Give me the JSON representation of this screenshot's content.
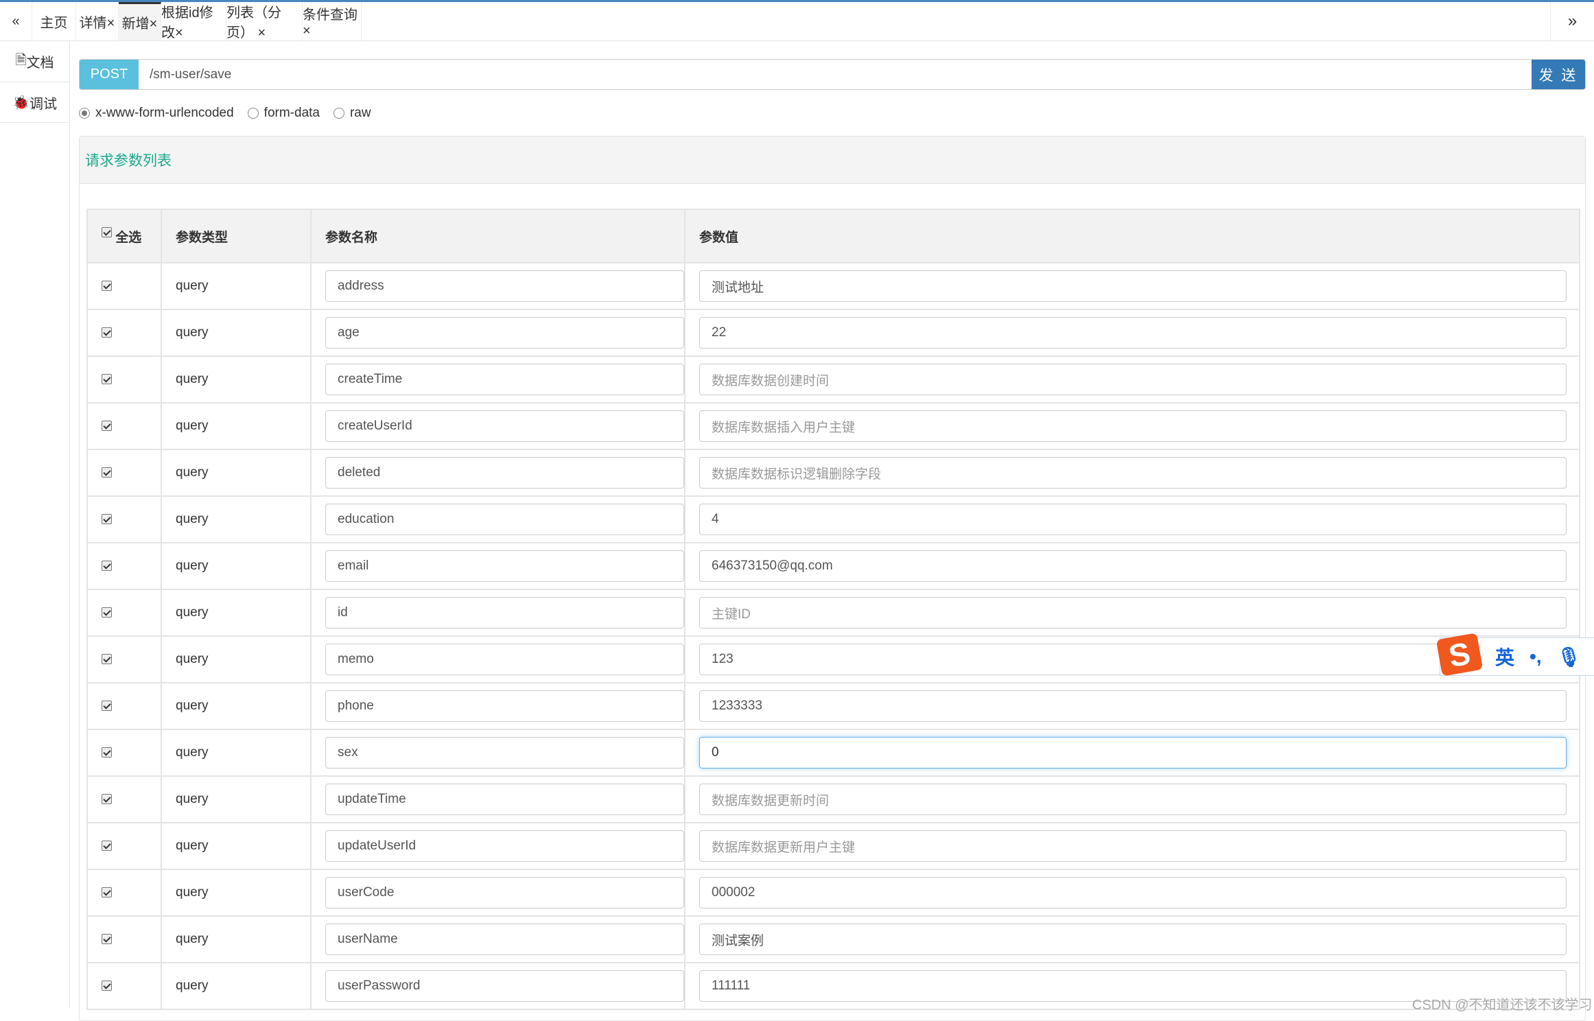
{
  "tabs": {
    "left_nav": "«",
    "right_nav": "»",
    "items": [
      {
        "label": "主页"
      },
      {
        "label": "详情×"
      },
      {
        "label": "新增×"
      },
      {
        "label": "根据id修改×"
      },
      {
        "label": "列表（分页） ×"
      },
      {
        "label": "条件查询×"
      }
    ],
    "active": 2
  },
  "sidebar": {
    "items": [
      {
        "label": "文档",
        "icon": "file-icon"
      },
      {
        "label": "调试",
        "icon": "bug-icon"
      }
    ]
  },
  "request": {
    "method": "POST",
    "url": "/sm-user/save",
    "send_label": "发 送",
    "method_color": "#5bc0de",
    "send_color": "#337ab7"
  },
  "body_types": [
    {
      "label": "x-www-form-urlencoded",
      "selected": true
    },
    {
      "label": "form-data",
      "selected": false
    },
    {
      "label": "raw",
      "selected": false
    }
  ],
  "panel": {
    "title": "请求参数列表"
  },
  "table": {
    "headers": {
      "select_all": "全选",
      "type": "参数类型",
      "name": "参数名称",
      "value": "参数值"
    },
    "rows": [
      {
        "type": "query",
        "name": "address",
        "value": "测试地址",
        "placeholder": ""
      },
      {
        "type": "query",
        "name": "age",
        "value": "22",
        "placeholder": ""
      },
      {
        "type": "query",
        "name": "createTime",
        "value": "",
        "placeholder": "数据库数据创建时间"
      },
      {
        "type": "query",
        "name": "createUserId",
        "value": "",
        "placeholder": "数据库数据插入用户主键"
      },
      {
        "type": "query",
        "name": "deleted",
        "value": "",
        "placeholder": "数据库数据标识逻辑删除字段"
      },
      {
        "type": "query",
        "name": "education",
        "value": "4",
        "placeholder": ""
      },
      {
        "type": "query",
        "name": "email",
        "value": "646373150@qq.com",
        "placeholder": ""
      },
      {
        "type": "query",
        "name": "id",
        "value": "",
        "placeholder": "主键ID"
      },
      {
        "type": "query",
        "name": "memo",
        "value": "123",
        "placeholder": ""
      },
      {
        "type": "query",
        "name": "phone",
        "value": "1233333",
        "placeholder": ""
      },
      {
        "type": "query",
        "name": "sex",
        "value": "0",
        "placeholder": "",
        "focused": true
      },
      {
        "type": "query",
        "name": "updateTime",
        "value": "",
        "placeholder": "数据库数据更新时间"
      },
      {
        "type": "query",
        "name": "updateUserId",
        "value": "",
        "placeholder": "数据库数据更新用户主键"
      },
      {
        "type": "query",
        "name": "userCode",
        "value": "000002",
        "placeholder": ""
      },
      {
        "type": "query",
        "name": "userName",
        "value": "测试案例",
        "placeholder": ""
      },
      {
        "type": "query",
        "name": "userPassword",
        "value": "111111",
        "placeholder": ""
      }
    ]
  },
  "ime": {
    "logo": "S",
    "mode": "英",
    "punct": "•,",
    "icon": "microphone-icon"
  },
  "watermark": "CSDN @不知道还该不该学习"
}
